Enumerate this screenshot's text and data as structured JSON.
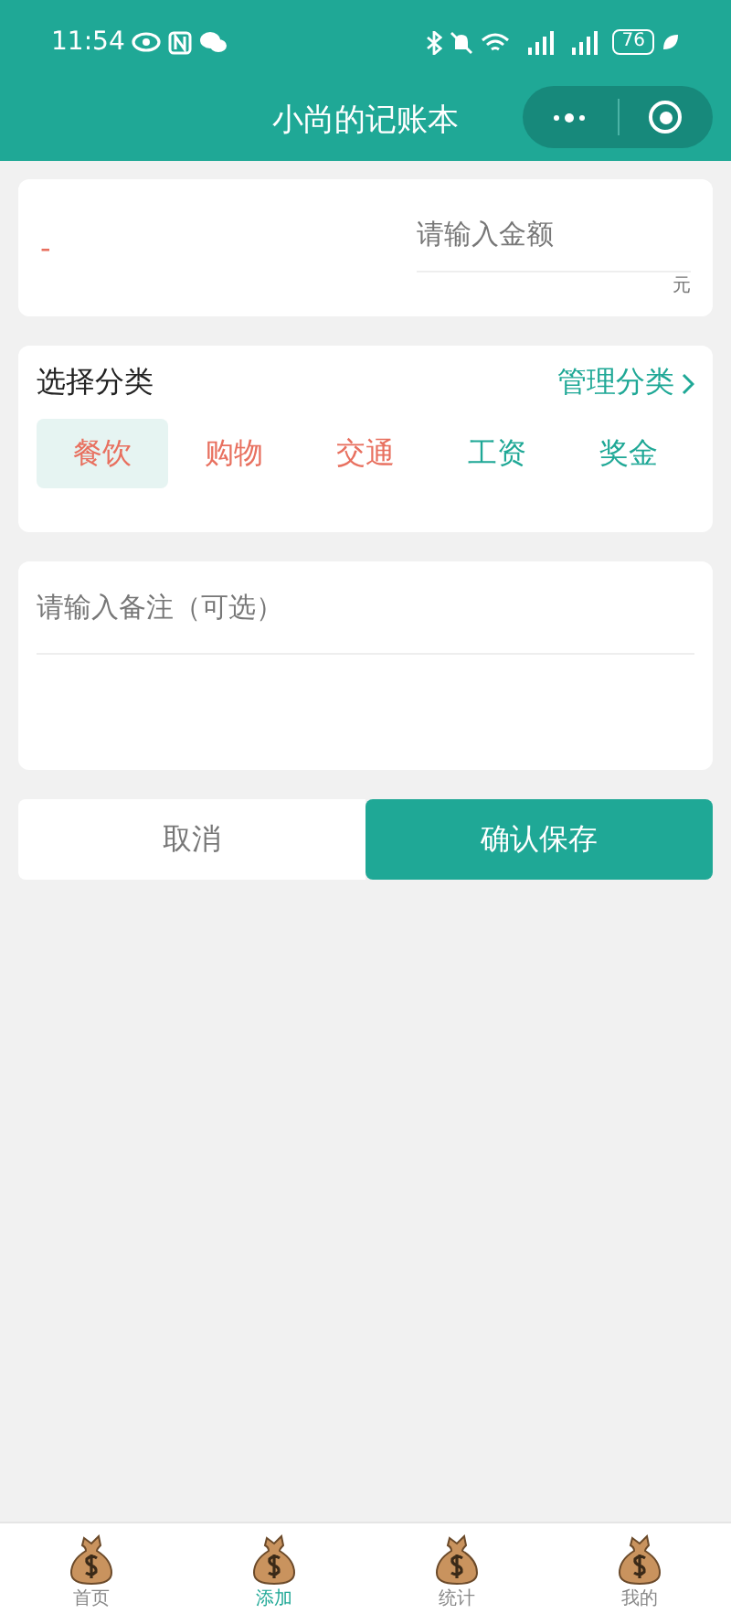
{
  "status_bar": {
    "time": "11:54",
    "battery": "76"
  },
  "title_bar": {
    "title": "小尚的记账本"
  },
  "amount": {
    "sign": "-",
    "placeholder": "请输入金额",
    "unit": "元"
  },
  "category": {
    "title": "选择分类",
    "manage_link": "管理分类",
    "items": [
      {
        "label": "餐饮",
        "selected": true,
        "color": "#e8705f"
      },
      {
        "label": "购物",
        "selected": false,
        "color": "#e8705f"
      },
      {
        "label": "交通",
        "selected": false,
        "color": "#e8705f"
      },
      {
        "label": "工资",
        "selected": false,
        "color": "#1fa896"
      },
      {
        "label": "奖金",
        "selected": false,
        "color": "#1fa896"
      }
    ]
  },
  "note": {
    "placeholder": "请输入备注（可选）"
  },
  "buttons": {
    "cancel": "取消",
    "confirm": "确认保存"
  },
  "tab_bar": [
    {
      "label": "首页",
      "selected": false
    },
    {
      "label": "添加",
      "selected": true
    },
    {
      "label": "统计",
      "selected": false
    },
    {
      "label": "我的",
      "selected": false
    }
  ]
}
